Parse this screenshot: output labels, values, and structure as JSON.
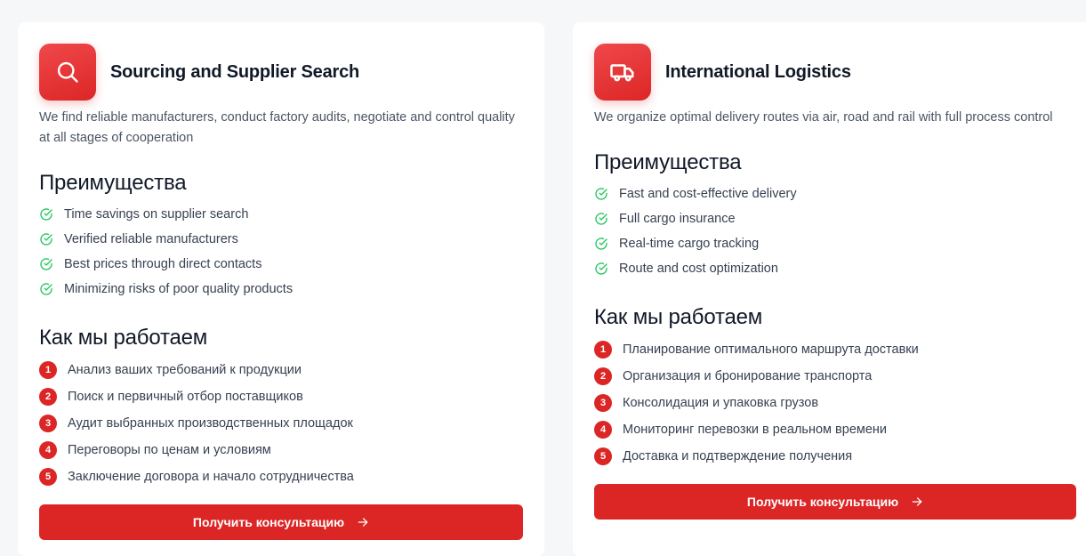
{
  "cards": [
    {
      "title": "Sourcing and Supplier Search",
      "icon": "search-icon",
      "description": "We find reliable manufacturers, conduct factory audits, negotiate and control quality at all stages of cooperation",
      "advantages_title": "Преимущества",
      "advantages": [
        "Time savings on supplier search",
        "Verified reliable manufacturers",
        "Best prices through direct contacts",
        "Minimizing risks of poor quality products"
      ],
      "steps_title": "Как мы работаем",
      "steps": [
        {
          "num": "1",
          "text": "Анализ ваших требований к продукции"
        },
        {
          "num": "2",
          "text": "Поиск и первичный отбор поставщиков"
        },
        {
          "num": "3",
          "text": "Аудит выбранных производственных площадок"
        },
        {
          "num": "4",
          "text": "Переговоры по ценам и условиям"
        },
        {
          "num": "5",
          "text": "Заключение договора и начало сотрудничества"
        }
      ],
      "cta_label": "Получить консультацию"
    },
    {
      "title": "International Logistics",
      "icon": "truck-icon",
      "description": "We organize optimal delivery routes via air, road and rail with full process control",
      "advantages_title": "Преимущества",
      "advantages": [
        "Fast and cost-effective delivery",
        "Full cargo insurance",
        "Real-time cargo tracking",
        "Route and cost optimization"
      ],
      "steps_title": "Как мы работаем",
      "steps": [
        {
          "num": "1",
          "text": "Планирование оптимального маршрута доставки"
        },
        {
          "num": "2",
          "text": "Организация и бронирование транспорта"
        },
        {
          "num": "3",
          "text": "Консолидация и упаковка грузов"
        },
        {
          "num": "4",
          "text": "Мониторинг перевозки в реальном времени"
        },
        {
          "num": "5",
          "text": "Доставка и подтверждение получения"
        }
      ],
      "cta_label": "Получить консультацию"
    }
  ],
  "colors": {
    "accent": "#dc2626",
    "check": "#22c55e",
    "text": "#111827",
    "muted": "#4b5563"
  }
}
